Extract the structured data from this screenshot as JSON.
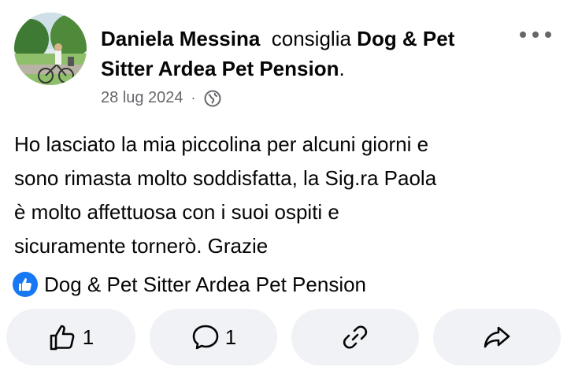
{
  "post": {
    "author": "Daniela Messina",
    "verb": "consiglia",
    "page_name": "Dog & Pet Sitter Ardea Pet Pension",
    "punctuation": ".",
    "date": "28 lug 2024",
    "separator": "·",
    "privacy_icon": "globe-icon",
    "body": "Ho lasciato la mia piccolina per alcuni giorni e\nsono rimasta molto soddisfatta, la Sig.ra Paola\nè molto affettuosa con i suoi ospiti  e\nsicuramente tornerò. Grazie"
  },
  "recommendation": {
    "icon": "thumbs-up-badge-icon",
    "page_name": "Dog & Pet Sitter Ardea Pet Pension"
  },
  "actions": {
    "like_count": "1",
    "comment_count": "1"
  },
  "colors": {
    "accent": "#1877f2",
    "secondary_text": "#65676b",
    "button_bg": "#f0f2f5"
  }
}
